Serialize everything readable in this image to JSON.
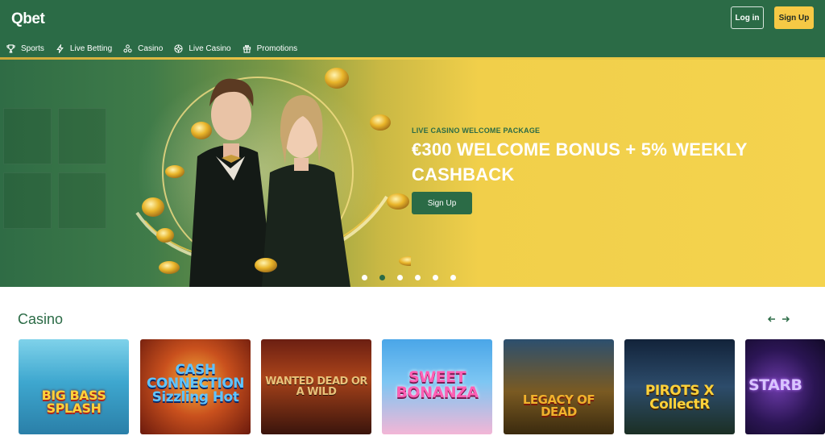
{
  "brand": {
    "logo": "Qbet",
    "primary": "#2b6b46",
    "accent": "#f6c945"
  },
  "header": {
    "login_label": "Log in",
    "signup_label": "Sign Up"
  },
  "nav": [
    {
      "label": "Sports",
      "icon": "trophy-icon"
    },
    {
      "label": "Live Betting",
      "icon": "lightning-icon"
    },
    {
      "label": "Casino",
      "icon": "chips-icon"
    },
    {
      "label": "Live Casino",
      "icon": "roulette-icon"
    },
    {
      "label": "Promotions",
      "icon": "gift-icon"
    }
  ],
  "hero": {
    "eyebrow": "LIVE CASINO WELCOME PACKAGE",
    "title": "€300 WELCOME BONUS + 5% WEEKLY CASHBACK",
    "cta_label": "Sign Up",
    "slide_count": 6,
    "active_slide": 2
  },
  "casino": {
    "title": "Casino",
    "games": [
      {
        "name": "BIG BASS SPLASH"
      },
      {
        "name": "CASH CONNECTION Sizzling Hot"
      },
      {
        "name": "WANTED DEAD OR A WILD"
      },
      {
        "name": "SWEET BONANZA"
      },
      {
        "name": "LEGACY OF DEAD"
      },
      {
        "name": "PIROTS X CollectR"
      },
      {
        "name": "STARB"
      }
    ]
  }
}
